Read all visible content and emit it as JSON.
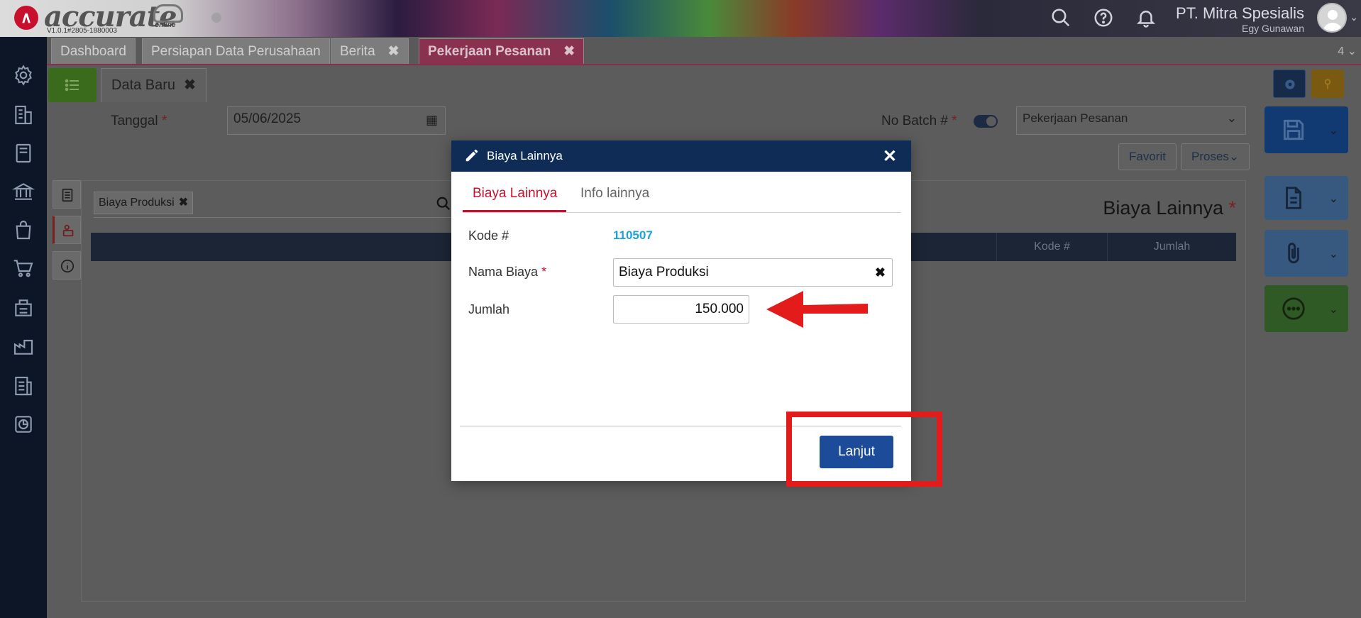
{
  "header": {
    "logo_text": "accurate",
    "logo_sub": "online",
    "version": "V1.0.1#2805-1880003",
    "company": "PT. Mitra Spesialis",
    "user": "Egy Gunawan",
    "icons": [
      "search-icon",
      "help-icon",
      "bell-icon"
    ]
  },
  "sidebar": {
    "icons": [
      "gear-icon",
      "building-icon",
      "book-icon",
      "bank-icon",
      "bag-icon",
      "cart-icon",
      "warehouse-icon",
      "factory-icon",
      "tax-icon",
      "report-icon"
    ]
  },
  "tabs": [
    {
      "label": "Dashboard",
      "closable": false
    },
    {
      "label": "Persiapan Data Perusahaan",
      "closable": false
    },
    {
      "label": "Berita",
      "closable": true
    },
    {
      "label": "Pekerjaan Pesanan",
      "closable": true,
      "active": true
    }
  ],
  "tab_count": "4",
  "subtab": {
    "label": "Data Baru"
  },
  "form": {
    "tanggal_label": "Tanggal",
    "tanggal_value": "05/06/2025",
    "batch_label": "No Batch #",
    "type_value": "Pekerjaan Pesanan",
    "favorit_label": "Favorit",
    "proses_label": "Proses"
  },
  "panel": {
    "chip_label": "Biaya Produksi",
    "title": "Biaya Lainnya",
    "columns": [
      "Kode #",
      "Jumlah"
    ]
  },
  "modal": {
    "title": "Biaya Lainnya",
    "tab_main": "Biaya Lainnya",
    "tab_info": "Info lainnya",
    "kode_label": "Kode #",
    "kode_value": "110507",
    "nama_label": "Nama Biaya",
    "nama_value": "Biaya Produksi",
    "jumlah_label": "Jumlah",
    "jumlah_value": "150.000",
    "continue_label": "Lanjut"
  },
  "colors": {
    "primary": "#1c4b9a",
    "modal_header": "#0f2c57",
    "accent_red": "#c8102e",
    "code_blue": "#1aa3d6",
    "annotation_red": "#e41b1b"
  }
}
